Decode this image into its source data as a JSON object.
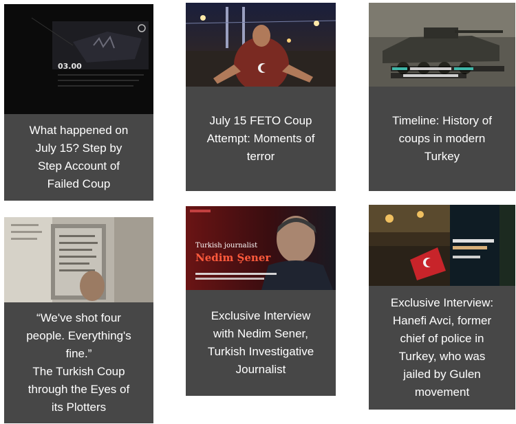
{
  "cards": [
    {
      "title_lines": [
        "What happened on",
        "July 15? Step by",
        "Step Account of",
        "Failed Coup"
      ],
      "thumb": {
        "time": "03.00"
      }
    },
    {
      "title_lines": [
        "July 15 FETO Coup",
        "Attempt: Moments of",
        "terror"
      ]
    },
    {
      "title_lines": [
        "Timeline: History of",
        "coups in modern",
        "Turkey"
      ]
    },
    {
      "title_lines": [
        "“We've shot four",
        "people. Everything's",
        "fine.”",
        "The Turkish Coup",
        "through the Eyes of",
        "its Plotters"
      ]
    },
    {
      "title_lines": [
        "Exclusive Interview",
        "with Nedim Sener,",
        "Turkish Investigative",
        "Journalist"
      ],
      "thumb": {
        "line1": "Turkish journalist",
        "name": "Nedim Şener"
      }
    },
    {
      "title_lines": [
        "Exclusive Interview:",
        "Hanefi Avci, former",
        "chief of police in",
        "Turkey, who was",
        "jailed by Gulen",
        "movement"
      ]
    }
  ]
}
